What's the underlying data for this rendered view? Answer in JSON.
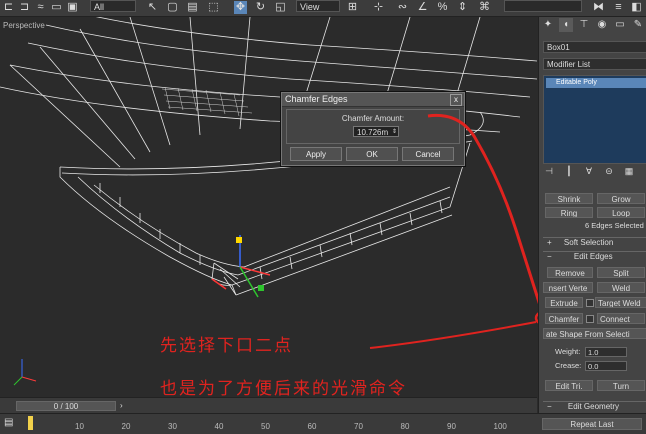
{
  "toolbar": {
    "selection_filter": "All",
    "reference_coord": "View"
  },
  "viewport": {
    "label": "Perspective"
  },
  "dialog": {
    "title": "Chamfer Edges",
    "amount_label": "Chamfer Amount:",
    "amount_value": "10.726m",
    "apply_label": "Apply",
    "ok_label": "OK",
    "cancel_label": "Cancel",
    "close_glyph": "x"
  },
  "panel": {
    "object_name": "Box01",
    "modifier_list": "Modifier List",
    "stack_item": "Editable Poly",
    "shrink": "Shrink",
    "grow": "Grow",
    "ring": "Ring",
    "loop": "Loop",
    "selection_status": "6 Edges Selected",
    "soft_selection": "Soft Selection",
    "edit_edges": "Edit Edges",
    "remove": "Remove",
    "split": "Split",
    "insert_vertex": "nsert Verte",
    "weld": "Weld",
    "extrude": "Extrude",
    "target_weld": "Target Weld",
    "chamfer": "Chamfer",
    "connect": "Connect",
    "create_shape": "ate Shape From Selecti",
    "weight_label": "Weight:",
    "weight_value": "1.0",
    "crease_label": "Crease:",
    "crease_value": "0.0",
    "edit_tri": "Edit Tri.",
    "turn": "Turn",
    "edit_geometry": "Edit Geometry",
    "repeat_last": "Repeat Last"
  },
  "timeline": {
    "position": "0 / 100",
    "ticks": [
      "10",
      "20",
      "30",
      "40",
      "50",
      "60",
      "70",
      "80",
      "90",
      "100"
    ]
  },
  "annotations": {
    "line1": "先选择下口二点",
    "line2": "也是为了方便后来的光滑命令",
    "color": "#e0231f"
  }
}
